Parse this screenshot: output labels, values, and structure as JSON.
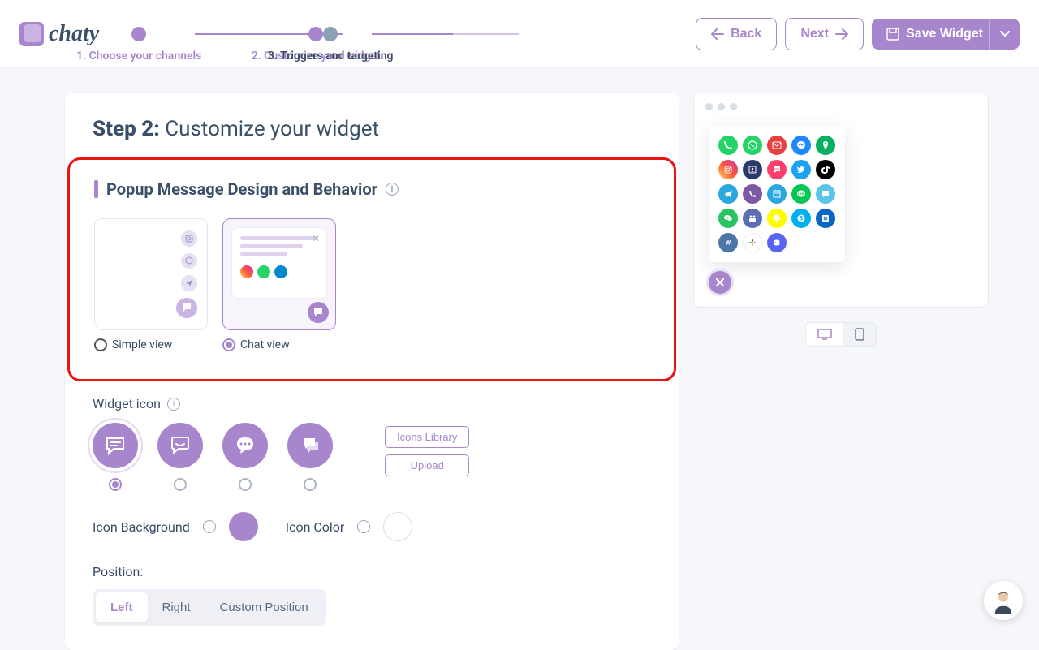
{
  "brand": "chaty",
  "steps": {
    "s1": "1. Choose your channels",
    "s2": "2. Customize your widget",
    "s3": "3. Triggers and targeting"
  },
  "header": {
    "back": "Back",
    "next": "Next",
    "save": "Save Widget"
  },
  "panel": {
    "title_prefix": "Step 2:",
    "title_rest": " Customize your widget",
    "popup_section": "Popup Message Design and Behavior",
    "view_simple": "Simple view",
    "view_chat": "Chat view",
    "widget_icon": "Widget icon",
    "icons_library": "Icons Library",
    "upload": "Upload",
    "icon_bg": "Icon Background",
    "icon_color": "Icon Color",
    "position": "Position:",
    "pos_left": "Left",
    "pos_right": "Right",
    "pos_custom": "Custom Position"
  },
  "preview": {
    "desktop": "desktop",
    "mobile": "mobile"
  },
  "colors": {
    "accent": "#a886cd",
    "accent_light": "#c9b4e4"
  },
  "preview_icons": [
    {
      "bg": "#25d366",
      "glyph": "phone"
    },
    {
      "bg": "#25d366",
      "glyph": "wa"
    },
    {
      "bg": "#e64040",
      "glyph": "mail"
    },
    {
      "bg": "#1e88ff",
      "glyph": "msgr"
    },
    {
      "bg": "#08b061",
      "glyph": "map"
    },
    {
      "bg": "linear-gradient(45deg,#fd5,#ff543e,#c837ab)",
      "glyph": "ig"
    },
    {
      "bg": "#2a3a6a",
      "glyph": "card"
    },
    {
      "bg": "#ff3e6c",
      "glyph": "sms"
    },
    {
      "bg": "#1da1f2",
      "glyph": "tw"
    },
    {
      "bg": "#000",
      "glyph": "tk"
    },
    {
      "bg": "#2aa7e0",
      "glyph": "tg"
    },
    {
      "bg": "#7b59a6",
      "glyph": "vb"
    },
    {
      "bg": "#2aa7e0",
      "glyph": "cal"
    },
    {
      "bg": "#06c755",
      "glyph": "line"
    },
    {
      "bg": "#5bc5e8",
      "glyph": "chat"
    },
    {
      "bg": "#2ac462",
      "glyph": "wc"
    },
    {
      "bg": "#5b6eb5",
      "glyph": "teams"
    },
    {
      "bg": "#fffc00",
      "glyph": "snap"
    },
    {
      "bg": "#00aff0",
      "glyph": "skype"
    },
    {
      "bg": "#0a66c2",
      "glyph": "li"
    },
    {
      "bg": "#4a76a8",
      "glyph": "vk"
    },
    {
      "bg": "#4a154b",
      "glyph": "slack"
    },
    {
      "bg": "#5865f2",
      "glyph": "disc"
    }
  ]
}
